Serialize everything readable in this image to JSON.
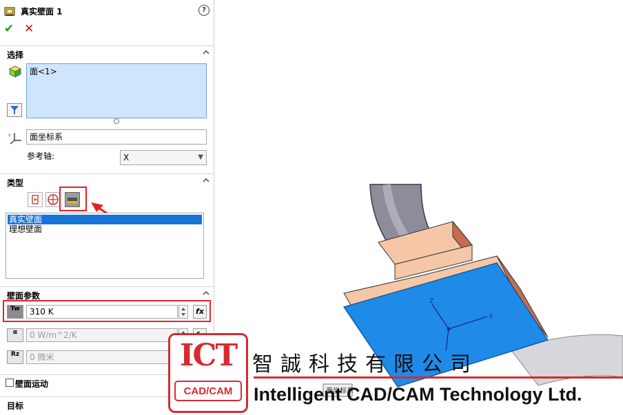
{
  "feature": {
    "title": "真实壁面 1",
    "help_label": "?",
    "ok_symbol": "✔",
    "cancel_symbol": "✕"
  },
  "selection": {
    "header": "选择",
    "face_item": "面<1>",
    "coord_system": "面坐标系",
    "ref_axis_label": "参考轴:",
    "ref_axis_value": "X"
  },
  "type": {
    "header": "类型",
    "options": [
      "真实壁面",
      "理想壁面"
    ],
    "selected": "真实壁面"
  },
  "wall_params": {
    "header": "壁面参数",
    "temperature": "310 K",
    "temp_icon": "Tw",
    "htc": "0 W/m^2/K",
    "htc_icon": "α",
    "roughness": "0 微米",
    "rough_icon": "Rz",
    "fx_label": "fx"
  },
  "wall_motion": {
    "label": "壁面运动"
  },
  "goals": {
    "header": "目标"
  },
  "viewport": {
    "tooltip": "面坐标系",
    "axes": {
      "x": "X",
      "z": "Z"
    }
  },
  "watermark": {
    "logo": "ICT",
    "logo_sub": "CAD/CAM",
    "chinese": "智誠科技有限公司",
    "english": "Intelligent CAD/CAM Technology Ltd."
  },
  "colors": {
    "highlight_red": "#e52222",
    "face_blue": "#1f8ae8",
    "part_orange": "#f5c7a6",
    "selection_blue": "#1673d8"
  }
}
